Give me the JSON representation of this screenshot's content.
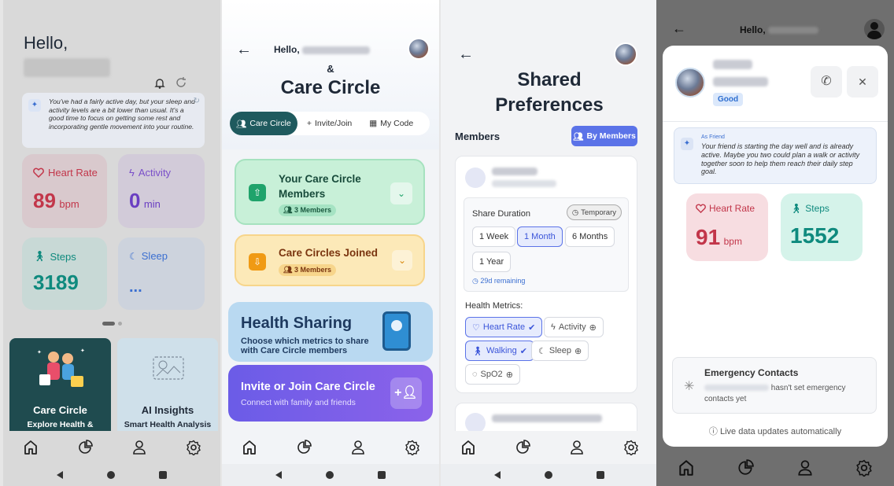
{
  "s1": {
    "hello": "Hello,",
    "insight": "You've had a fairly active day, but your sleep and activity levels are a bit lower than usual. It's a good time to focus on getting some rest and incorporating gentle movement into your routine.",
    "heart": {
      "label": "Heart Rate",
      "value": "89",
      "unit": "bpm"
    },
    "activity": {
      "label": "Activity",
      "value": "0",
      "unit": "min"
    },
    "steps": {
      "label": "Steps",
      "value": "3189"
    },
    "sleep": {
      "label": "Sleep",
      "value": "..."
    },
    "promo1": {
      "title": "Care Circle",
      "sub": "Explore Health &"
    },
    "promo2": {
      "title": "AI Insights",
      "sub": "Smart Health Analysis"
    }
  },
  "s2": {
    "hello": "Hello,",
    "amp": "&",
    "title": "Care Circle",
    "tabs": [
      "Care Circle",
      "Invite/Join",
      "My Code"
    ],
    "members": {
      "title": "Your Care Circle Members",
      "badge": "3 Members"
    },
    "joined": {
      "title": "Care Circles Joined",
      "badge": "3 Members"
    },
    "sharing": {
      "title": "Health Sharing",
      "sub": "Choose which metrics to share with Care Circle members"
    },
    "invite": {
      "title": "Invite or Join Care Circle",
      "sub": "Connect with family and friends"
    }
  },
  "s3": {
    "title": "Shared Preferences",
    "members_label": "Members",
    "by_members": "By Members",
    "share_duration": "Share Duration",
    "temporary": "Temporary",
    "durations": [
      "1 Week",
      "1 Month",
      "6 Months",
      "1 Year"
    ],
    "remaining": "29d remaining",
    "metrics_label": "Health Metrics:",
    "metrics": [
      "Heart Rate",
      "Activity",
      "Walking",
      "Sleep",
      "SpO2"
    ]
  },
  "s4": {
    "hello": "Hello,",
    "status": "Good",
    "as_friend": "As Friend",
    "friend_msg": "Your friend is starting the day well and is already active. Maybe you two could plan a walk or activity together soon to help them reach their daily step goal.",
    "heart": {
      "label": "Heart Rate",
      "value": "91",
      "unit": "bpm"
    },
    "steps": {
      "label": "Steps",
      "value": "1552"
    },
    "emergency_title": "Emergency Contacts",
    "emergency_msg": "hasn't set emergency contacts yet",
    "live": "Live data updates automatically"
  },
  "colors": {
    "teal": "#0f766e",
    "purple": "#6d5ce8",
    "green_bg": "#c8f0d8",
    "yellow_bg": "#fce9b8",
    "red": "#c2364a"
  }
}
